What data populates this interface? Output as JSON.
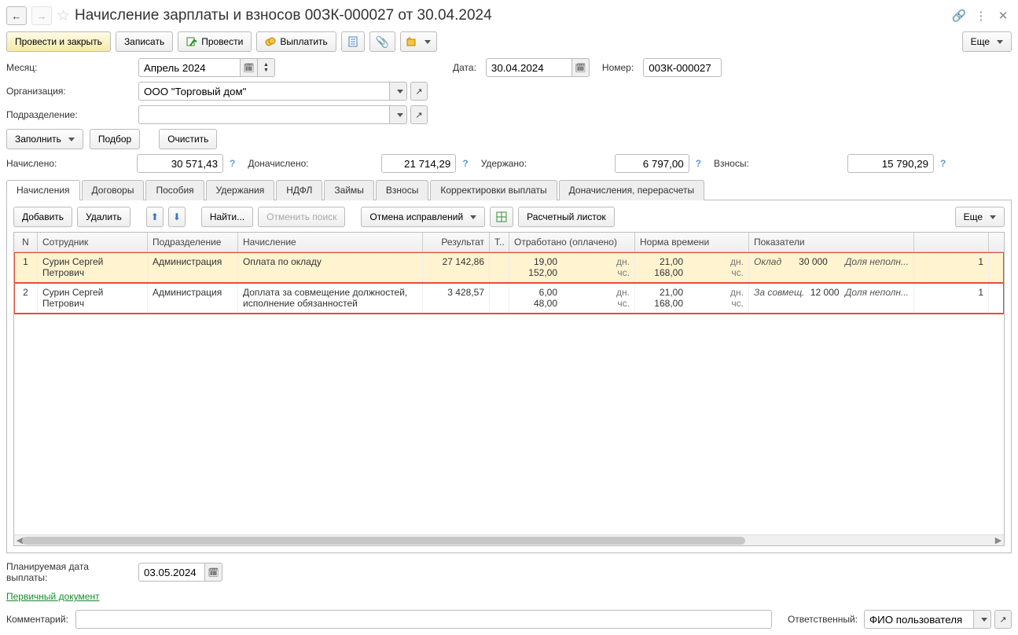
{
  "header": {
    "title": "Начисление зарплаты и взносов 00ЗК-000027 от 30.04.2024"
  },
  "toolbar": {
    "post_close": "Провести и закрыть",
    "save": "Записать",
    "post": "Провести",
    "pay": "Выплатить",
    "more": "Еще"
  },
  "form": {
    "month_label": "Месяц:",
    "month": "Апрель 2024",
    "date_label": "Дата:",
    "date": "30.04.2024",
    "number_label": "Номер:",
    "number": "00ЗК-000027",
    "org_label": "Организация:",
    "org": "ООО \"Торговый дом\"",
    "dept_label": "Подразделение:",
    "dept": "",
    "fill": "Заполнить",
    "pick": "Подбор",
    "clear": "Очистить"
  },
  "totals": {
    "accrued_label": "Начислено:",
    "accrued": "30 571,43",
    "extra_accrued_label": "Доначислено:",
    "extra_accrued": "21 714,29",
    "withheld_label": "Удержано:",
    "withheld": "6 797,00",
    "contrib_label": "Взносы:",
    "contrib": "15 790,29"
  },
  "tabs": [
    "Начисления",
    "Договоры",
    "Пособия",
    "Удержания",
    "НДФЛ",
    "Займы",
    "Взносы",
    "Корректировки выплаты",
    "Доначисления, перерасчеты"
  ],
  "tab_active": 0,
  "tab_toolbar": {
    "add": "Добавить",
    "delete": "Удалить",
    "find": "Найти...",
    "cancel_find": "Отменить поиск",
    "cancel_fix": "Отмена исправлений",
    "payslip": "Расчетный листок",
    "more": "Еще"
  },
  "grid": {
    "headers": {
      "n": "N",
      "emp": "Сотрудник",
      "dep": "Подразделение",
      "acc": "Начисление",
      "res": "Результат",
      "t": "Т..",
      "work": "Отработано (оплачено)",
      "norm": "Норма времени",
      "ind": "Показатели",
      "last": ""
    },
    "rows": [
      {
        "n": "1",
        "emp": "Сурин Сергей Петрович",
        "dep": "Администрация",
        "acc": "Оплата по окладу",
        "res": "27 142,86",
        "work_days": "19,00",
        "work_days_unit": "дн.",
        "work_hours": "152,00",
        "work_hours_unit": "чс.",
        "norm_days": "21,00",
        "norm_days_unit": "дн.",
        "norm_hours": "168,00",
        "norm_hours_unit": "чс.",
        "ind_name": "Оклад",
        "ind_val": "30 000",
        "ind_extra": "Доля неполн...",
        "last": "1"
      },
      {
        "n": "2",
        "emp": "Сурин Сергей Петрович",
        "dep": "Администрация",
        "acc": "Доплата за совмещение должностей, исполнение обязанностей",
        "res": "3 428,57",
        "work_days": "6,00",
        "work_days_unit": "дн.",
        "work_hours": "48,00",
        "work_hours_unit": "чс.",
        "norm_days": "21,00",
        "norm_days_unit": "дн.",
        "norm_hours": "168,00",
        "norm_hours_unit": "чс.",
        "ind_name": "За совмещ.",
        "ind_val": "12 000",
        "ind_extra": "Доля неполн...",
        "last": "1"
      }
    ]
  },
  "footer": {
    "plan_date_label": "Планируемая дата выплаты:",
    "plan_date": "03.05.2024",
    "primary_doc": "Первичный документ",
    "comment_label": "Комментарий:",
    "comment": "",
    "responsible_label": "Ответственный:",
    "responsible": "ФИО пользователя"
  }
}
